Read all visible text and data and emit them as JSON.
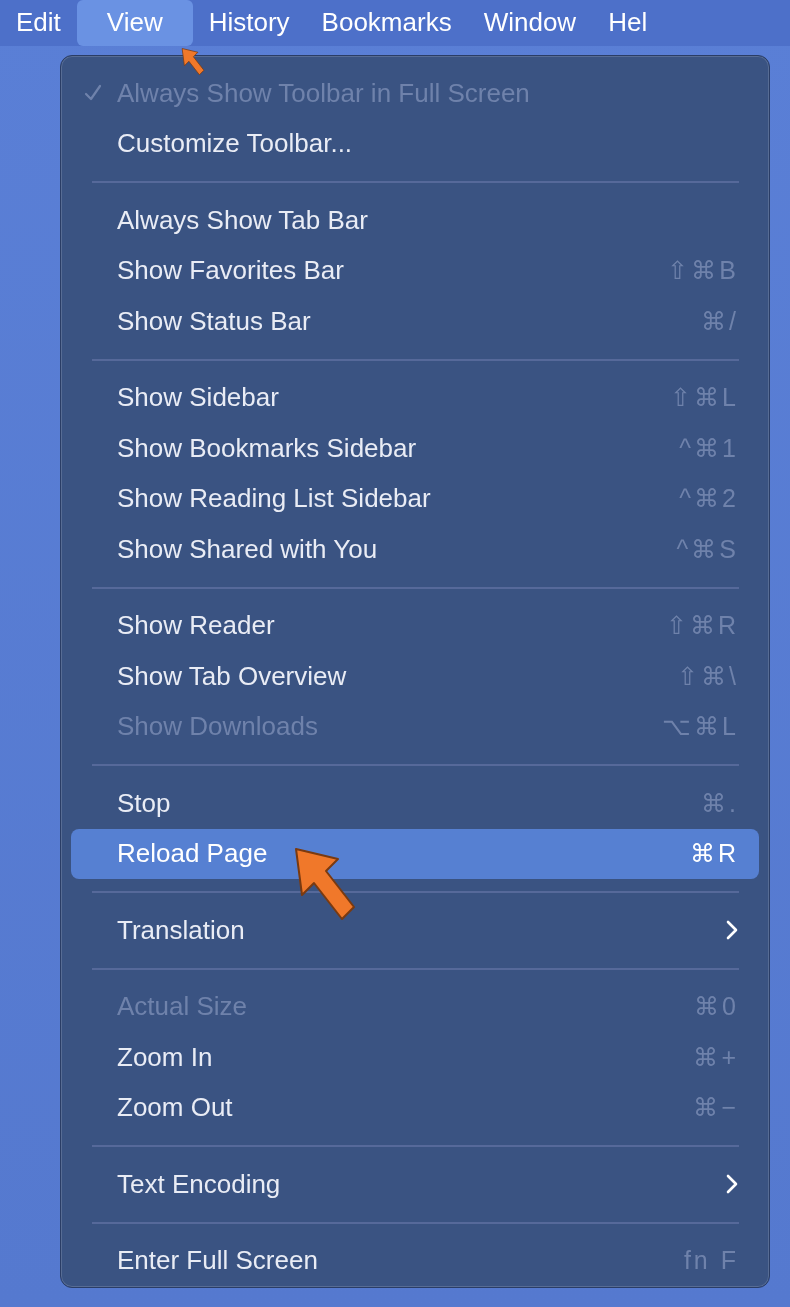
{
  "menu_bar": [
    {
      "label": "Edit",
      "selected": false
    },
    {
      "label": "View",
      "selected": true
    },
    {
      "label": "History",
      "selected": false
    },
    {
      "label": "Bookmarks",
      "selected": false
    },
    {
      "label": "Window",
      "selected": false
    },
    {
      "label": "Hel",
      "selected": false
    }
  ],
  "menu": {
    "sections": [
      [
        {
          "kind": "item",
          "label": "Always Show Toolbar in Full Screen",
          "checked": true,
          "disabled": true,
          "selected": false
        },
        {
          "kind": "item",
          "label": "Customize Toolbar...",
          "checked": false,
          "disabled": false,
          "selected": false
        }
      ],
      [
        {
          "kind": "item",
          "label": "Always Show Tab Bar",
          "checked": false,
          "disabled": false,
          "selected": false
        },
        {
          "kind": "item",
          "label": "Show Favorites Bar",
          "shortcut": "⇧⌘B",
          "checked": false,
          "disabled": false,
          "selected": false
        },
        {
          "kind": "item",
          "label": "Show Status Bar",
          "shortcut": "⌘/",
          "checked": false,
          "disabled": false,
          "selected": false
        }
      ],
      [
        {
          "kind": "item",
          "label": "Show Sidebar",
          "shortcut": "⇧⌘L",
          "checked": false,
          "disabled": false,
          "selected": false
        },
        {
          "kind": "item",
          "label": "Show Bookmarks Sidebar",
          "shortcut": "^⌘1",
          "checked": false,
          "disabled": false,
          "selected": false
        },
        {
          "kind": "item",
          "label": "Show Reading List Sidebar",
          "shortcut": "^⌘2",
          "checked": false,
          "disabled": false,
          "selected": false
        },
        {
          "kind": "item",
          "label": "Show Shared with You",
          "shortcut": "^⌘S",
          "checked": false,
          "disabled": false,
          "selected": false
        }
      ],
      [
        {
          "kind": "item",
          "label": "Show Reader",
          "shortcut": "⇧⌘R",
          "checked": false,
          "disabled": false,
          "selected": false
        },
        {
          "kind": "item",
          "label": "Show Tab Overview",
          "shortcut": "⇧⌘\\",
          "checked": false,
          "disabled": false,
          "selected": false
        },
        {
          "kind": "item",
          "label": "Show Downloads",
          "shortcut": "⌥⌘L",
          "checked": false,
          "disabled": true,
          "selected": false
        }
      ],
      [
        {
          "kind": "item",
          "label": "Stop",
          "shortcut": "⌘.",
          "checked": false,
          "disabled": false,
          "selected": false
        },
        {
          "kind": "item",
          "label": "Reload Page",
          "shortcut": "⌘R",
          "checked": false,
          "disabled": false,
          "selected": true
        }
      ],
      [
        {
          "kind": "submenu",
          "label": "Translation",
          "checked": false,
          "disabled": false,
          "selected": false
        }
      ],
      [
        {
          "kind": "item",
          "label": "Actual Size",
          "shortcut": "⌘0",
          "checked": false,
          "disabled": true,
          "selected": false
        },
        {
          "kind": "item",
          "label": "Zoom In",
          "shortcut": "⌘+",
          "checked": false,
          "disabled": false,
          "selected": false
        },
        {
          "kind": "item",
          "label": "Zoom Out",
          "shortcut": "⌘−",
          "checked": false,
          "disabled": false,
          "selected": false
        }
      ],
      [
        {
          "kind": "submenu",
          "label": "Text Encoding",
          "checked": false,
          "disabled": false,
          "selected": false
        }
      ],
      [
        {
          "kind": "item",
          "label": "Enter Full Screen",
          "shortcut": "fn F",
          "checked": false,
          "disabled": false,
          "selected": false
        }
      ]
    ]
  }
}
